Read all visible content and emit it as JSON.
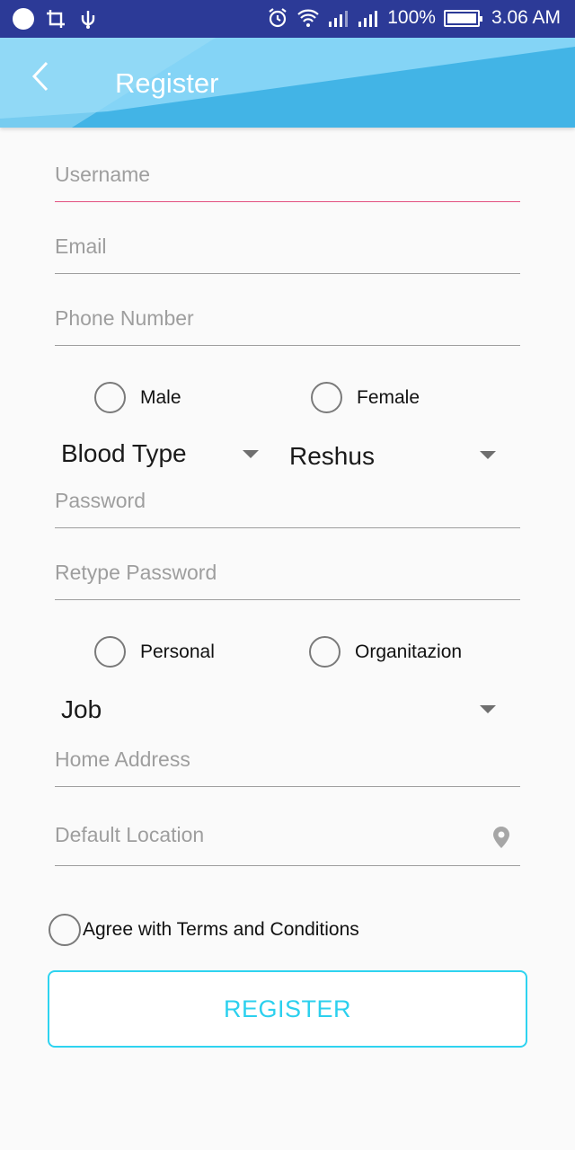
{
  "status_bar": {
    "battery": "100%",
    "time": "3.06 AM"
  },
  "header": {
    "title": "Register"
  },
  "form": {
    "username": "Username",
    "email": "Email",
    "phone": "Phone Number",
    "gender": {
      "male": "Male",
      "female": "Female"
    },
    "blood_type": "Blood Type",
    "rhesus": "Reshus",
    "password": "Password",
    "retype_password": "Retype Password",
    "account_type": {
      "personal": "Personal",
      "organization": "Organitazion"
    },
    "job": "Job",
    "home_address": "Home Address",
    "default_location": "Default Location",
    "terms": "Agree with Terms and Conditions",
    "register_button": "REGISTER"
  },
  "colors": {
    "status_bar": "#2c3a97",
    "app_bar": "#42b4e6",
    "focus_line": "#e2507f",
    "button_accent": "#2ed3f0"
  },
  "icons": {
    "back": "chevron-left-icon",
    "location": "map-pin-icon",
    "dropdown": "triangle-down-icon"
  }
}
